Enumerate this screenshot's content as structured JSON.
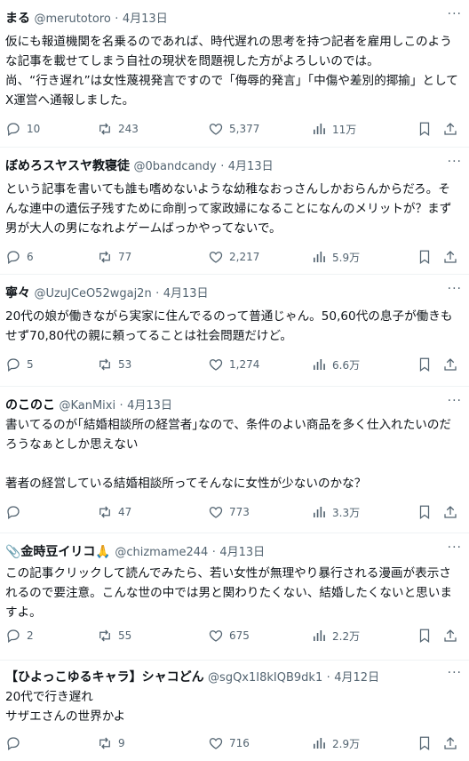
{
  "tweets": [
    {
      "name": "まる",
      "handle": "@merutotoro",
      "date": "4月13日",
      "text": "仮にも報道機関を名乗るのであれば、時代遅れの思考を持つ記者を雇用しこのような記事を載せてしまう自社の現状を問題視した方がよろしいのでは。\n尚、“行き遅れ”は女性蔑視発言ですので「侮辱的発言」「中傷や差別的揶揄」としてX運営へ通報しました。",
      "replies": "10",
      "retweets": "243",
      "likes": "5,377",
      "views": "11万"
    },
    {
      "name": "ぼめろスヤスヤ教寝徒",
      "handle": "@0bandcandy",
      "date": "4月13日",
      "text": "という記事を書いても誰も嗜めないような幼稚なおっさんしかおらんからだろ。そんな連中の遺伝子残すために命削って家政婦になることになんのメリットが？まず男が大人の男になれよゲームばっかやってないで。",
      "replies": "6",
      "retweets": "77",
      "likes": "2,217",
      "views": "5.9万"
    },
    {
      "name": "寧々",
      "handle": "@UzuJCeO52wgaj2n",
      "date": "4月13日",
      "text": "20代の娘が働きながら実家に住んでるのって普通じゃん。50,60代の息子が働きもせず70,80代の親に頼ってることは社会問題だけど。",
      "replies": "5",
      "retweets": "53",
      "likes": "1,274",
      "views": "6.6万"
    },
    {
      "name": "のこのこ",
      "handle": "@KanMixi",
      "date": "4月13日",
      "text": "書いてるのが｢結婚相談所の経営者｣なので、条件のよい商品を多く仕入れたいのだろうなぁとしか思えない\n\n著者の経営している結婚相談所ってそんなに女性が少ないのかな？",
      "replies": "",
      "retweets": "47",
      "likes": "773",
      "views": "3.3万"
    },
    {
      "name": "📎金時豆イリコ🙏",
      "handle": "@chizmame244",
      "date": "4月13日",
      "text": "この記事クリックして読んでみたら、若い女性が無理やり暴行される漫画が表示されるので要注意。こんな世の中では男と関わりたくない、結婚したくないと思いますよ。",
      "replies": "2",
      "retweets": "55",
      "likes": "675",
      "views": "2.2万"
    },
    {
      "name": "【ひよっこゆるキャラ】シャコどん",
      "handle": "@sgQx1I8kIQB9dk1",
      "date": "4月12日",
      "text": "20代で行き遅れ\nサザエさんの世界かよ",
      "replies": "",
      "retweets": "9",
      "likes": "716",
      "views": "2.9万"
    }
  ],
  "more_label": "···",
  "dot": "·"
}
